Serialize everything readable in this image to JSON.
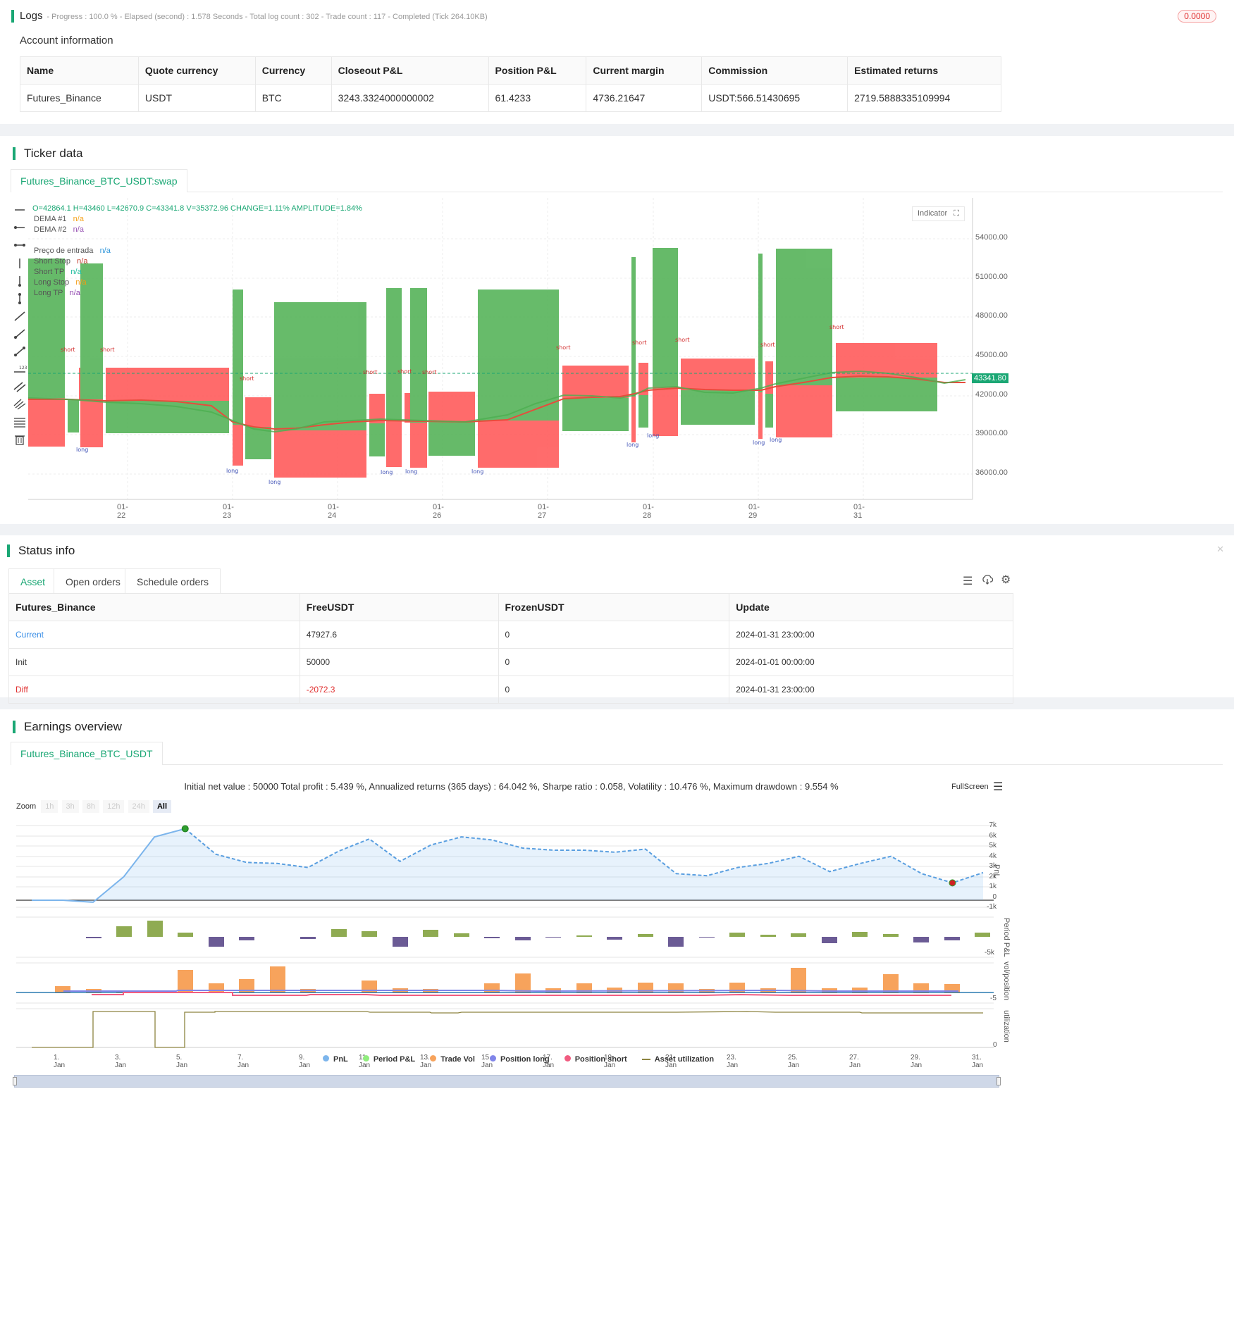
{
  "logs": {
    "title": "Logs",
    "summary": "- Progress : 100.0 % - Elapsed (second) : 1.578  Seconds - Total log count : 302 - Trade count : 117 - Completed (Tick 264.10KB)",
    "badge": "0.0000"
  },
  "account": {
    "title": "Account information",
    "headers": [
      "Name",
      "Quote currency",
      "Currency",
      "Closeout P&L",
      "Position P&L",
      "Current margin",
      "Commission",
      "Estimated returns"
    ],
    "row": [
      "Futures_Binance",
      "USDT",
      "BTC",
      "3243.3324000000002",
      "61.4233",
      "4736.21647",
      "USDT:566.51430695",
      "2719.5888335109994"
    ]
  },
  "ticker": {
    "title": "Ticker data",
    "tab": "Futures_Binance_BTC_USDT:swap",
    "ohlc": "O=42864.1 H=43460 L=42670.9 C=43341.8 V=35372.96 CHANGE=1.11% AMPLITUDE=1.84%",
    "legend": [
      {
        "label": "DEMA #1",
        "value": "n/a",
        "color": "#f5a623"
      },
      {
        "label": "DEMA #2",
        "value": "n/a",
        "color": "#9b59b6"
      },
      {
        "label": "Preço de entrada",
        "value": "n/a",
        "color": "#3498db"
      },
      {
        "label": "Short Stop",
        "value": "n/a",
        "color": "#c0392b"
      },
      {
        "label": "Short TP",
        "value": "n/a",
        "color": "#1abc9c"
      },
      {
        "label": "Long Stop",
        "value": "n/a",
        "color": "#f39c12"
      },
      {
        "label": "Long TP",
        "value": "n/a",
        "color": "#8e44ad"
      }
    ],
    "indicator_button": "Indicator",
    "price_ticks": [
      "54000.00",
      "51000.00",
      "48000.00",
      "45000.00",
      "42000.00",
      "39000.00",
      "36000.00"
    ],
    "current_price": "43341.80",
    "date_ticks": [
      "01-22",
      "01-23",
      "01-24",
      "01-26",
      "01-27",
      "01-28",
      "01-29",
      "01-31"
    ],
    "tool_icons": [
      "horizontal-line-icon",
      "horizontal-ray-icon",
      "horizontal-segment-icon",
      "vertical-line-icon",
      "vertical-arrow-icon",
      "vertical-segment-icon",
      "trend-line-icon",
      "ray-icon",
      "segment-icon",
      "price-label-icon",
      "parallel-channel-icon",
      "pitchfork-icon",
      "fibonacci-icon",
      "trash-icon"
    ]
  },
  "status": {
    "title": "Status info",
    "tabs": [
      "Asset",
      "Open orders",
      "Schedule orders"
    ],
    "headers": [
      "Futures_Binance",
      "FreeUSDT",
      "FrozenUSDT",
      "Update"
    ],
    "rows": [
      {
        "name": "Current",
        "free": "47927.6",
        "frozen": "0",
        "update": "2024-01-31 23:00:00"
      },
      {
        "name": "Init",
        "free": "50000",
        "frozen": "0",
        "update": "2024-01-01 00:00:00"
      },
      {
        "name": "Diff",
        "free": "-2072.3",
        "frozen": "0",
        "update": "2024-01-31 23:00:00"
      }
    ]
  },
  "earnings": {
    "title": "Earnings overview",
    "tab": "Futures_Binance_BTC_USDT",
    "summary": "Initial net value : 50000 Total profit : 5.439 %, Annualized returns (365 days) : 64.042 %, Sharpe ratio : 0.058, Volatility : 10.476 %, Maximum drawdown : 9.554 %",
    "fullscreen": "FullScreen",
    "zoom_label": "Zoom",
    "zoom_buttons": [
      "1h",
      "3h",
      "8h",
      "12h",
      "24h",
      "All"
    ],
    "pnl_ticks": [
      "7k",
      "6k",
      "5k",
      "4k",
      "3k",
      "2k",
      "1k",
      "0",
      "-1k"
    ],
    "axis_titles": [
      "PnL",
      "Period P&L",
      "vol/position",
      "utilization"
    ],
    "minor_ticks": [
      "-5k",
      "-5",
      "0"
    ],
    "x_ticks": [
      "1. Jan",
      "3. Jan",
      "5. Jan",
      "7. Jan",
      "9. Jan",
      "11. Jan",
      "13. Jan",
      "15. Jan",
      "17. Jan",
      "19. Jan",
      "21. Jan",
      "23. Jan",
      "25. Jan",
      "27. Jan",
      "29. Jan",
      "31. Jan"
    ],
    "legend": [
      {
        "label": "PnL",
        "color": "#7cb5ec"
      },
      {
        "label": "Period P&L",
        "color": "#90ed7d"
      },
      {
        "label": "Trade Vol",
        "color": "#f7a35c"
      },
      {
        "label": "Position long",
        "color": "#8085e9"
      },
      {
        "label": "Position short",
        "color": "#f15c80"
      },
      {
        "label": "Asset utilization",
        "color": "#8d8440"
      }
    ],
    "chart_data": {
      "type": "line",
      "x": [
        "1. Jan",
        "2. Jan",
        "3. Jan",
        "4. Jan",
        "5. Jan",
        "6. Jan",
        "7. Jan",
        "8. Jan",
        "9. Jan",
        "10. Jan",
        "11. Jan",
        "12. Jan",
        "13. Jan",
        "14. Jan",
        "15. Jan",
        "16. Jan",
        "17. Jan",
        "18. Jan",
        "19. Jan",
        "20. Jan",
        "21. Jan",
        "22. Jan",
        "23. Jan",
        "24. Jan",
        "25. Jan",
        "26. Jan",
        "27. Jan",
        "28. Jan",
        "29. Jan",
        "30. Jan",
        "31. Jan",
        "1. Feb"
      ],
      "series": [
        {
          "name": "PnL",
          "values": [
            0,
            0,
            -200,
            2300,
            6200,
            7000,
            4500,
            3700,
            3600,
            3200,
            4800,
            6000,
            3800,
            5400,
            6200,
            5900,
            5100,
            4900,
            4900,
            4700,
            5000,
            2600,
            2400,
            3200,
            3600,
            4300,
            2800,
            3600,
            4300,
            2600,
            1700,
            2700
          ]
        }
      ],
      "ylim": [
        -1000,
        7500
      ]
    }
  }
}
